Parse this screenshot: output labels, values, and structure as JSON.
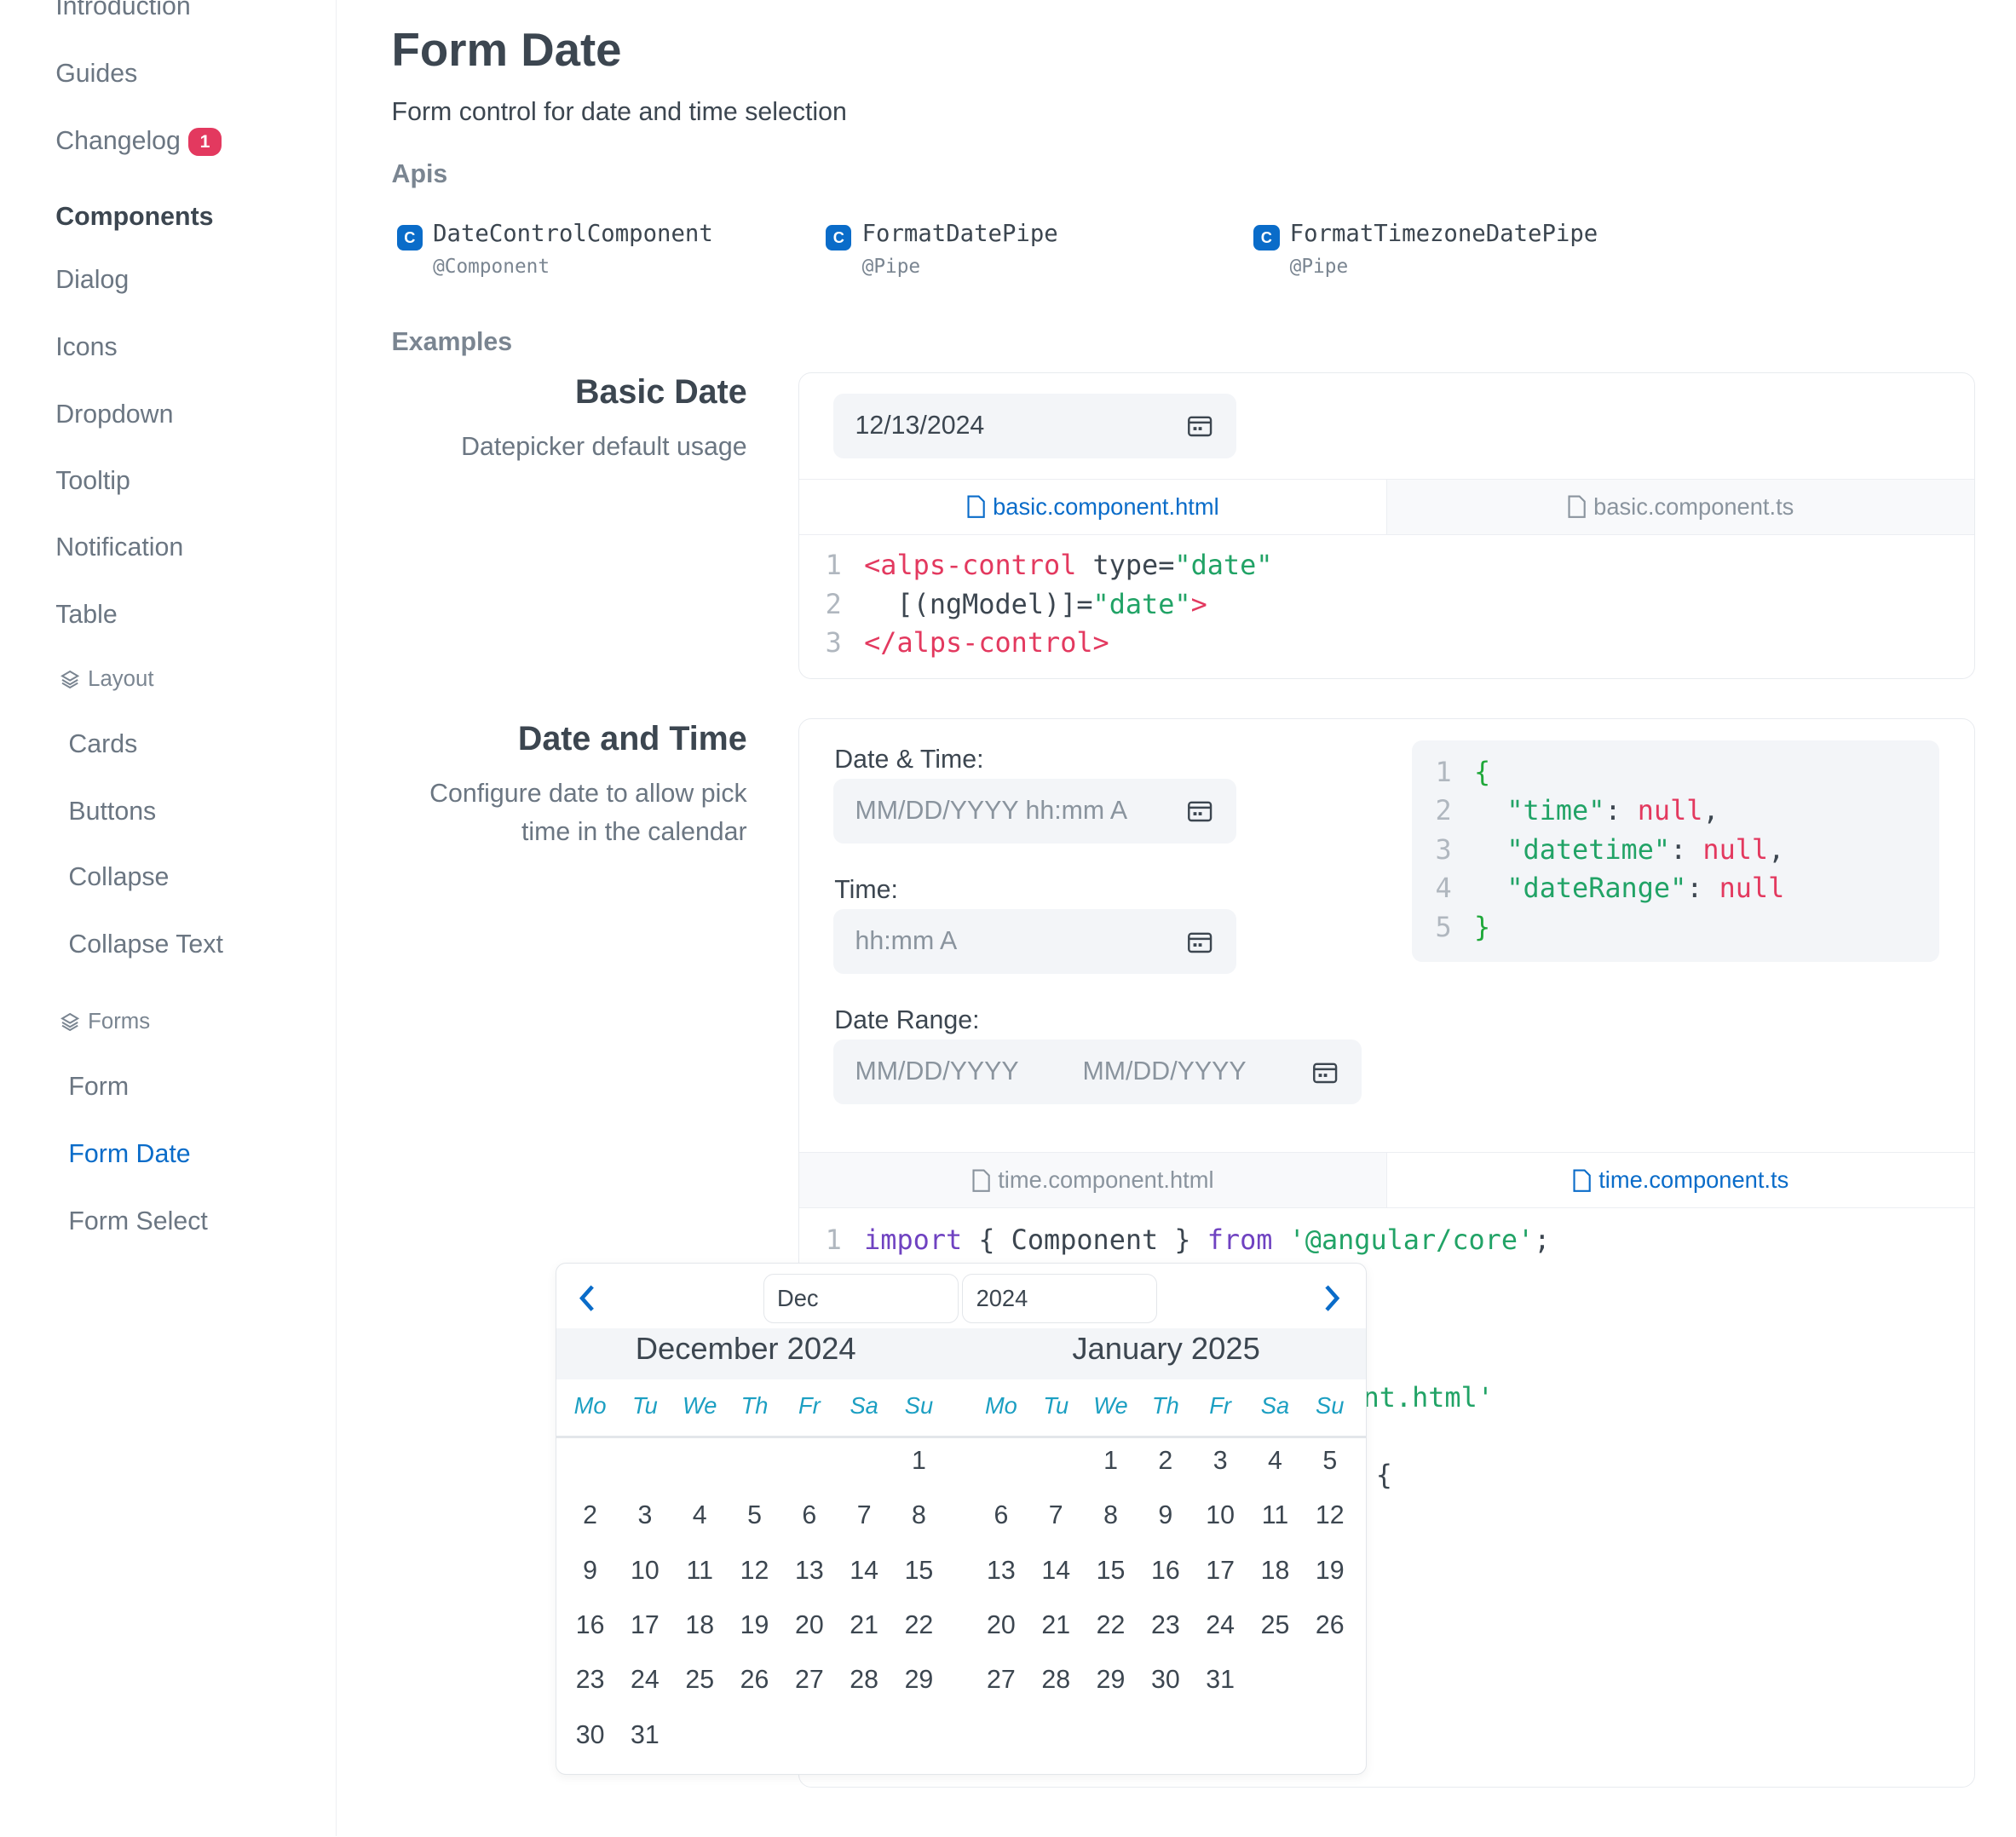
{
  "sidebar": {
    "items": [
      {
        "label": "Introduction"
      },
      {
        "label": "Guides"
      },
      {
        "label": "Changelog",
        "badge": "1"
      },
      {
        "label": "Components"
      },
      {
        "label": "Dialog"
      },
      {
        "label": "Icons"
      },
      {
        "label": "Dropdown"
      },
      {
        "label": "Tooltip"
      },
      {
        "label": "Notification"
      },
      {
        "label": "Table"
      }
    ],
    "layout_group": "Layout",
    "layout_items": [
      "Cards",
      "Buttons",
      "Collapse",
      "Collapse Text"
    ],
    "forms_group": "Forms",
    "forms_items": [
      "Form",
      "Form Date",
      "Form Select"
    ],
    "active": "Form Date"
  },
  "page": {
    "title": "Form Date",
    "subtitle": "Form control for date and time selection",
    "apis_label": "Apis",
    "examples_label": "Examples"
  },
  "apis": [
    {
      "badge": "C",
      "name": "DateControlComponent",
      "decorator": "@Component"
    },
    {
      "badge": "C",
      "name": "FormatDatePipe",
      "decorator": "@Pipe"
    },
    {
      "badge": "C",
      "name": "FormatTimezoneDatePipe",
      "decorator": "@Pipe"
    }
  ],
  "basic": {
    "title": "Basic Date",
    "desc": "Datepicker default usage",
    "value": "12/13/2024",
    "tabs": [
      "basic.component.html",
      "basic.component.ts"
    ],
    "code": {
      "l1a": "<alps-control",
      "l1b": " type=",
      "l1c": "\"date\"",
      "l2a": "  [(ngModel)]=",
      "l2b": "\"date\"",
      "l2c": ">",
      "l3": "</alps-control>"
    }
  },
  "datetime": {
    "title": "Date and Time",
    "desc1": "Configure date to allow pick",
    "desc2": "time in the calendar",
    "dt_label": "Date & Time:",
    "dt_placeholder": "MM/DD/YYYY hh:mm A",
    "time_label": "Time:",
    "time_placeholder": "hh:mm A",
    "range_label": "Date Range:",
    "range_start_placeholder": "MM/DD/YYYY",
    "range_end_placeholder": "MM/DD/YYYY",
    "json": {
      "open": "{",
      "k1": "\"time\"",
      "k2": "\"datetime\"",
      "k3": "\"dateRange\"",
      "null": "null",
      "close": "}"
    },
    "tabs": [
      "time.component.html",
      "time.component.ts"
    ],
    "code": {
      "import": "import",
      "comp": " { Component } ",
      "from": "from",
      "mod": " '@angular/core'",
      "semi": ";",
      "frag1": "nt.html'",
      "frag2": "{"
    }
  },
  "calendar": {
    "month_select": "Dec",
    "year_select": "2024",
    "months": [
      {
        "name": "December 2024",
        "offset": 6,
        "days": 31
      },
      {
        "name": "January 2025",
        "offset": 2,
        "days": 31
      }
    ],
    "weekdays": [
      "Mo",
      "Tu",
      "We",
      "Th",
      "Fr",
      "Sa",
      "Su"
    ]
  },
  "colors": {
    "accent": "#0a6cc9",
    "badge": "#e3395f",
    "weekday": "#1c9fc2"
  }
}
